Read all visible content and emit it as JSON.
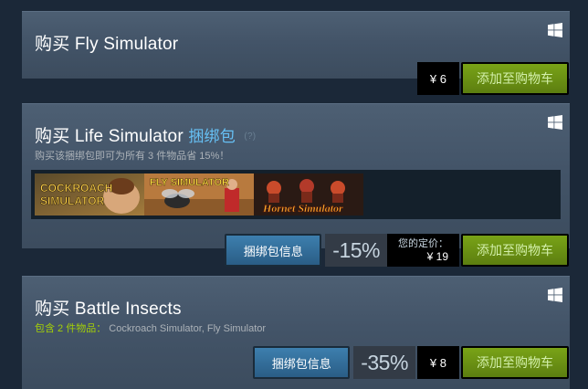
{
  "panels": [
    {
      "title": "购买 Fly Simulator",
      "price": "¥ 6",
      "cart_label": "添加至购物车"
    },
    {
      "title_prefix": "购买 Life Simulator",
      "bundle_word": "捆绑包",
      "help": "(?)",
      "subtitle": "购买该捆绑包即可为所有 3 件物品省 15%！",
      "capsules": [
        {
          "caption": "COCKROACH SIMULATOR"
        },
        {
          "caption": "FLY SIMULATOR"
        },
        {
          "caption": "Hornet Simulator"
        }
      ],
      "info_label": "捆绑包信息",
      "discount": "-15%",
      "your_price_label": "您的定价：",
      "final_price": "¥ 19",
      "cart_label": "添加至购物车"
    },
    {
      "title": "购买 Battle Insects",
      "includes_label": "包含 2 件物品：",
      "includes_items": "Cockroach Simulator, Fly Simulator",
      "info_label": "捆绑包信息",
      "discount": "-35%",
      "price": "¥ 8",
      "cart_label": "添加至购物车"
    }
  ],
  "colors": {
    "accent_blue": "#66c0f4",
    "cart_green": "#79a317",
    "includes_green": "#a4d007"
  },
  "icons": [
    "windows-icon"
  ]
}
